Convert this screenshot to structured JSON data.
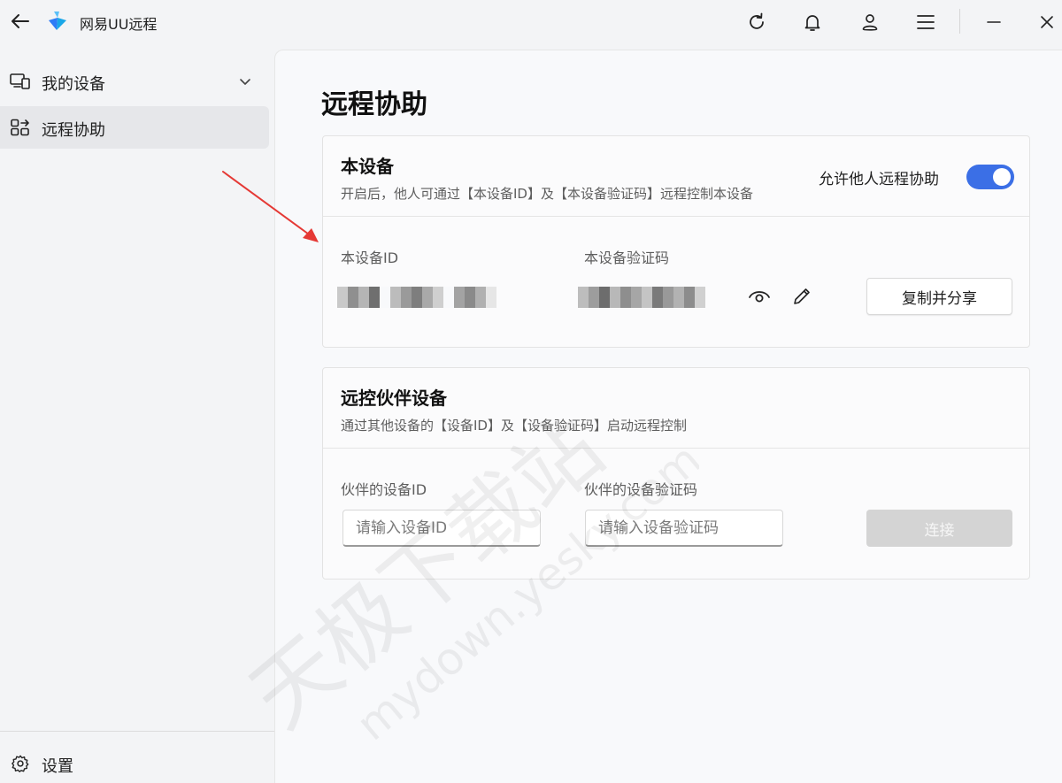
{
  "app": {
    "title": "网易UU远程"
  },
  "titlebar": {
    "icons": [
      "back-arrow-icon",
      "refresh-icon",
      "bell-icon",
      "user-icon",
      "menu-icon",
      "minimize-icon",
      "close-icon"
    ]
  },
  "sidebar": {
    "items": [
      {
        "label": "我的设备",
        "icon": "devices-icon",
        "expandable": true
      },
      {
        "label": "远程协助",
        "icon": "remote-assist-icon",
        "active": true
      }
    ],
    "settings_label": "设置"
  },
  "main": {
    "title": "远程协助",
    "this_device": {
      "title": "本设备",
      "desc": "开启后，他人可通过【本设备ID】及【本设备验证码】远程控制本设备",
      "toggle_label": "允许他人远程协助",
      "toggle_on": true,
      "id_label": "本设备ID",
      "code_label": "本设备验证码",
      "copy_button": "复制并分享"
    },
    "partner": {
      "title": "远控伙伴设备",
      "desc": "通过其他设备的【设备ID】及【设备验证码】启动远程控制",
      "id_label": "伙伴的设备ID",
      "code_label": "伙伴的设备验证码",
      "id_placeholder": "请输入设备ID",
      "code_placeholder": "请输入设备验证码",
      "connect_button": "连接"
    }
  },
  "watermark": {
    "line1": "天极下载站",
    "line2": "mydown.yesky.com"
  },
  "colors": {
    "accent": "#3b6fe6",
    "annotation": "#e53935"
  }
}
